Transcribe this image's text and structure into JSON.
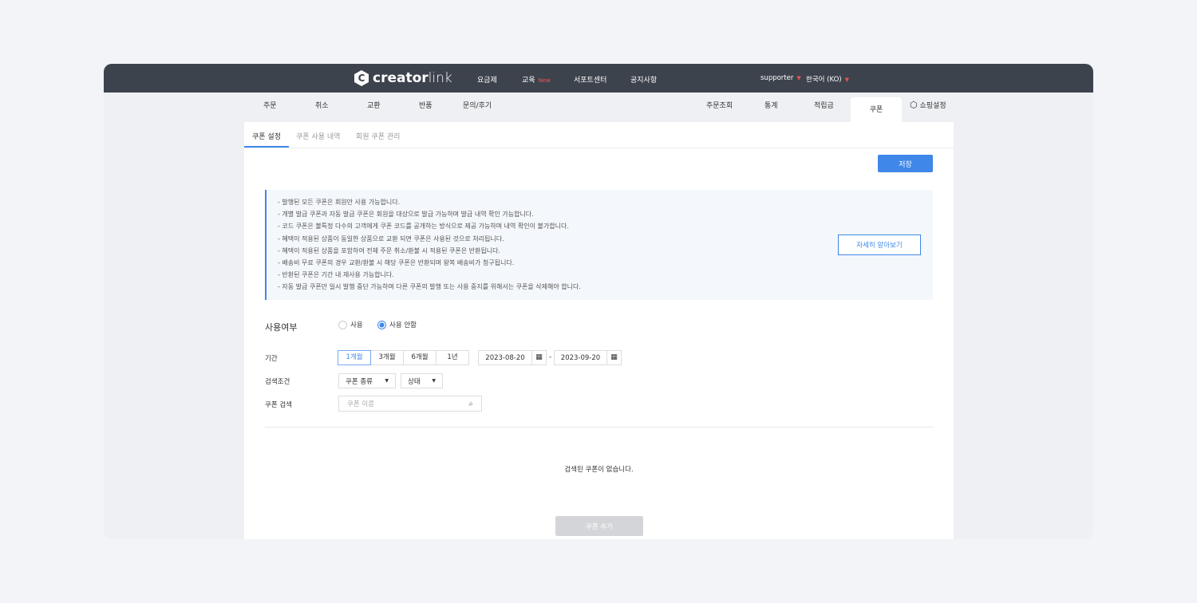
{
  "header": {
    "logo": {
      "bold": "creator",
      "light": "link"
    },
    "nav": [
      {
        "label": "요금제"
      },
      {
        "label": "교육",
        "badge": "New"
      },
      {
        "label": "서포트센터"
      },
      {
        "label": "공지사항"
      }
    ],
    "user": "supporter",
    "language": "한국어 (KO)"
  },
  "tabs": {
    "left": [
      "주문",
      "취소",
      "교환",
      "반품",
      "문의/후기"
    ],
    "right": [
      "주문조회",
      "통계",
      "적립금",
      "쿠폰"
    ],
    "active": "쿠폰",
    "settings": "쇼핑설정"
  },
  "subtabs": [
    "쿠폰 설정",
    "쿠폰 사용 내역",
    "회원 쿠폰 관리"
  ],
  "save_label": "저장",
  "notice": {
    "lines": [
      "- 발행된 모든 쿠폰은 회원만 사용 가능합니다.",
      "- 개별 발급 쿠폰과 자동 발급 쿠폰은 회원을 대상으로 발급 가능하며 발급 내역 확인 가능합니다.",
      "- 코드 쿠폰은 불특정 다수의 고객에게 쿠폰 코드를 공개하는 방식으로 제공 가능하며 내역 확인이 불가합니다.",
      "- 혜택이 적용된 상품이 동일한 상품으로 교환 되면 쿠폰은 사용된 것으로 처리됩니다.",
      "- 혜택이 적용된 상품을 포함하여 전체 주문 취소/환불 시 적용된 쿠폰은 반환됩니다.",
      "- 배송비 무료 쿠폰의 경우 교환/환불 시 해당 쿠폰은 반환되며 왕복 배송비가 청구됩니다.",
      "- 반환된 쿠폰은 기간 내 재사용 가능합니다.",
      "- 자동 발급 쿠폰만 일시 발행 중단 가능하며 다른 쿠폰의 발행 또는 사용 중지를 위해서는 쿠폰을 삭제해야 합니다."
    ],
    "more_label": "자세히 알아보기"
  },
  "form": {
    "usage": {
      "label": "사용여부",
      "options": [
        "사용",
        "사용 안함"
      ],
      "selected": "사용 안함"
    },
    "period": {
      "label": "기간",
      "options": [
        "1개월",
        "3개월",
        "6개월",
        "1년"
      ],
      "selected": "1개월",
      "start": "2023-08-20",
      "end": "2023-09-20",
      "separator": "-"
    },
    "filter": {
      "label": "검색조건",
      "type": "쿠폰 종류",
      "status": "상태"
    },
    "search": {
      "label": "쿠폰 검색",
      "placeholder": "쿠폰 이름"
    }
  },
  "empty_message": "검색된 쿠폰이 없습니다.",
  "add_label": "쿠폰 추가",
  "colors": {
    "accent": "#3f87e8",
    "header": "#3d434d",
    "new_badge": "#ff4d4d"
  }
}
